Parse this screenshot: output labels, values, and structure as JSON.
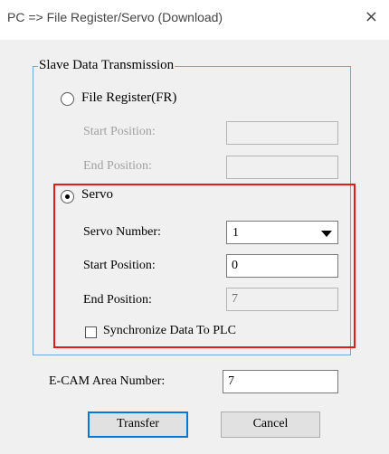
{
  "window": {
    "title": "PC => File Register/Servo (Download)"
  },
  "group": {
    "label": "Slave Data Transmission"
  },
  "file_register": {
    "label": "File Register(FR)",
    "start_label": "Start Position:",
    "start_value": "",
    "end_label": "End Position:",
    "end_value": ""
  },
  "servo": {
    "label": "Servo",
    "number_label": "Servo Number:",
    "number_value": "1",
    "start_label": "Start Position:",
    "start_value": "0",
    "end_label": "End Position:",
    "end_value": "7",
    "sync_label": "Synchronize Data To PLC"
  },
  "ecam": {
    "label": "E-CAM Area Number:",
    "value": "7"
  },
  "buttons": {
    "transfer": "Transfer",
    "cancel": "Cancel"
  },
  "colors": {
    "highlight_border": "#e21a1a",
    "group_border": "#6fa8dc",
    "default_button_border": "#0078d7"
  },
  "icons": {
    "close": "×"
  }
}
